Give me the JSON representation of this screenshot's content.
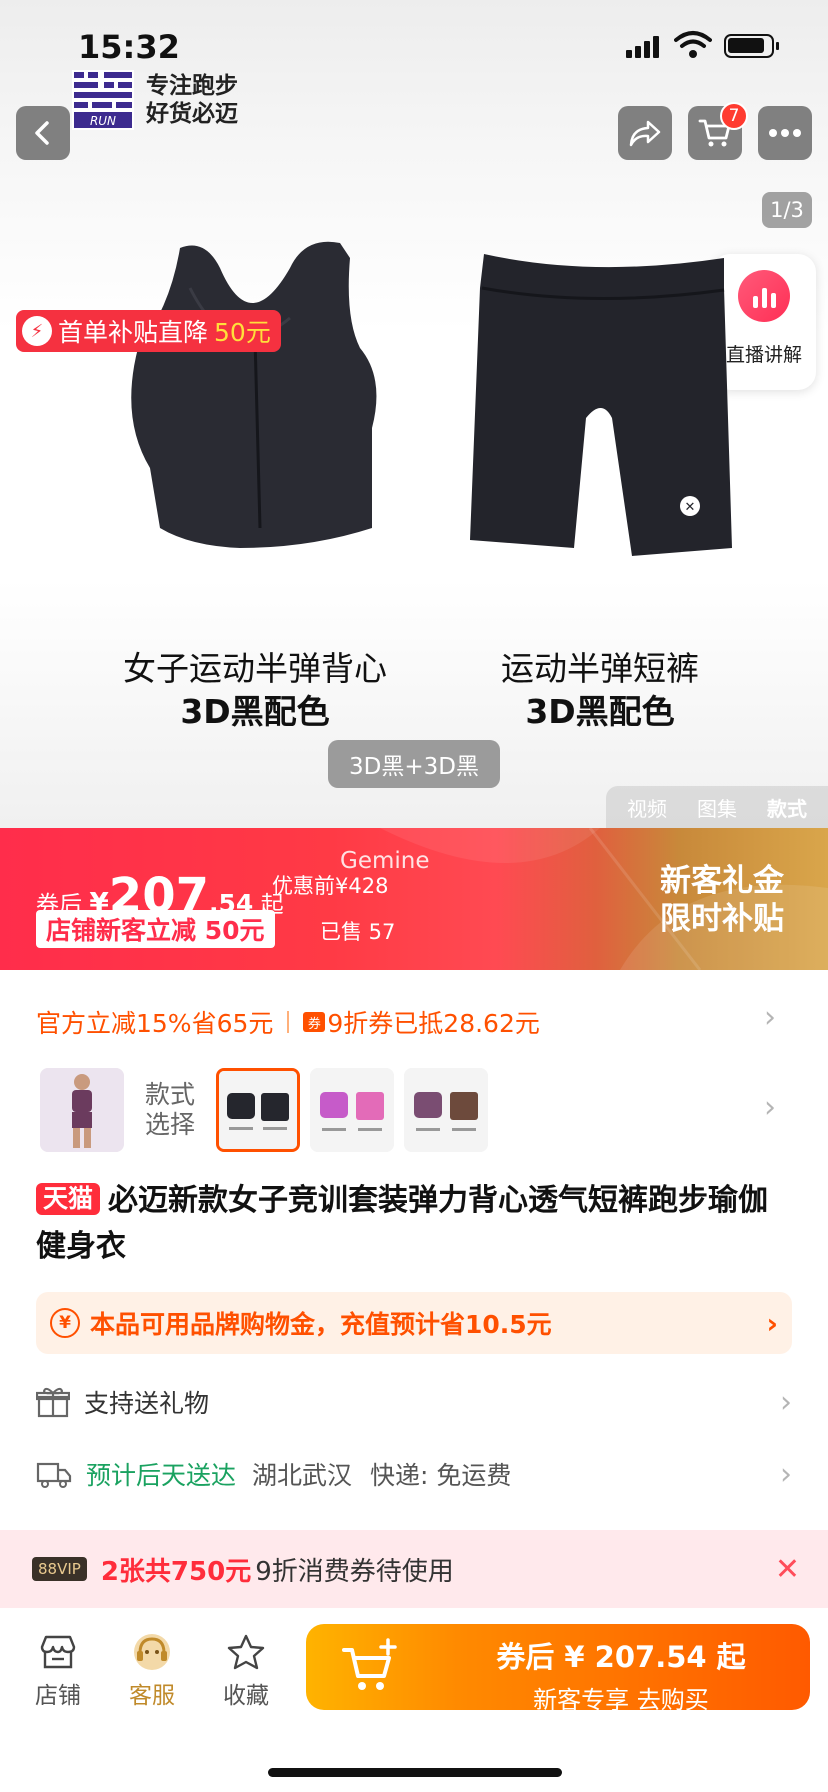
{
  "status_bar": {
    "time": "15:32"
  },
  "shop": {
    "slogan_line1": "专注跑步",
    "slogan_line2": "好货必迈",
    "logo_text": "RUN"
  },
  "header": {
    "cart_count": "7"
  },
  "gallery": {
    "page_indicator": "1/3",
    "live_label": "直播讲解",
    "promo_text": "首单补贴直降",
    "promo_amount": "50元",
    "item1_name": "女子运动半弹背心",
    "item1_color": "3D黑配色",
    "item2_name": "运动半弹短裤",
    "item2_color": "3D黑配色",
    "selected_variant": "3D黑+3D黑",
    "tabs": [
      "视频",
      "图集",
      "款式"
    ]
  },
  "price_banner": {
    "after_label": "券后",
    "currency": "¥",
    "price_int": "207",
    "price_dec": ".54",
    "from": "起",
    "original_price": "优惠前¥428",
    "watermark": "Gemine",
    "coupon": "店铺新客立减 50元",
    "sold": "已售 57",
    "gift_line1": "新客礼金",
    "gift_line2": "限时补贴"
  },
  "offers": {
    "official": "官方立减15%省65元",
    "coupon_icon": "券",
    "discount": "9折券已抵28.62元"
  },
  "styles": {
    "label": "款式\n选择"
  },
  "product": {
    "badge": "天猫",
    "title": "必迈新款女子竞训套装弹力背心透气短裤跑步瑜伽健身衣"
  },
  "brand_gold": {
    "icon": "¥",
    "text": "本品可用品牌购物金，充值预计省10.5元"
  },
  "gift": {
    "text": "支持送礼物"
  },
  "shipping": {
    "eta": "预计后天送达",
    "origin": "湖北武汉",
    "courier": "快递: 免运费"
  },
  "vip": {
    "tag": "88VIP",
    "highlight": "2张共750元",
    "rest": "9折消费券待使用"
  },
  "bottom_bar": {
    "store": "店铺",
    "service": "客服",
    "favorite": "收藏",
    "buy_line1": "券后 ¥ 207.54 起",
    "buy_line2": "新客专享 去购买"
  },
  "colors": {
    "accent": "#ff5000",
    "tmall_red": "#ff2d3b",
    "green": "#1aa260"
  }
}
